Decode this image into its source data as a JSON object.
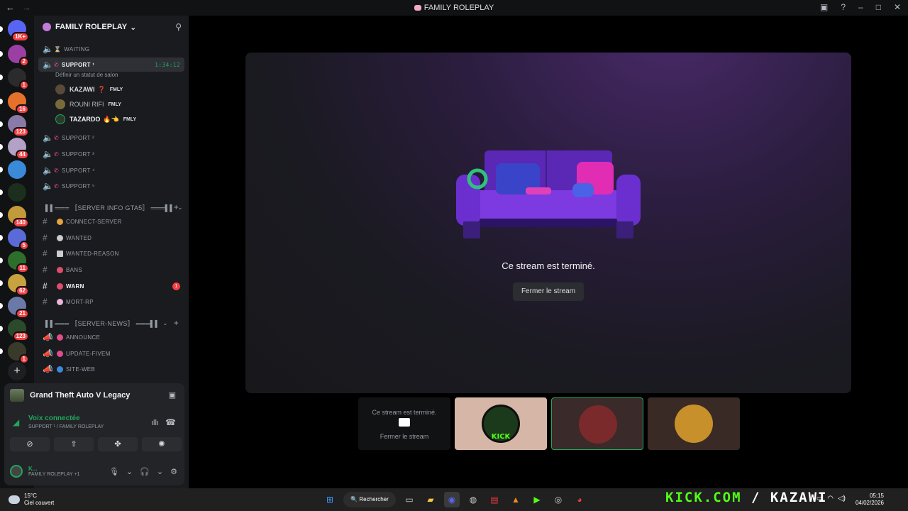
{
  "window": {
    "title": "FAMILY ROLEPLAY"
  },
  "rail": {
    "servers": [
      {
        "badge": "1K+",
        "color": "#5865f2"
      },
      {
        "badge": "2",
        "color": "#9b3fa4"
      },
      {
        "badge": "1",
        "color": "#2b2b2b"
      },
      {
        "badge": "16",
        "color": "#e5712b"
      },
      {
        "badge": "123",
        "color": "#8a7aa8"
      },
      {
        "badge": "44",
        "color": "#b3a1c7"
      },
      {
        "badge": "",
        "color": "#3b8ad9"
      },
      {
        "badge": "",
        "color": "#1c2e1c"
      },
      {
        "badge": "140",
        "color": "#c29a3a"
      },
      {
        "badge": "5",
        "color": "#5a6bd9"
      },
      {
        "badge": "11",
        "color": "#2d6e2d"
      },
      {
        "badge": "62",
        "color": "#c8a23f"
      },
      {
        "badge": "21",
        "color": "#6a79a8"
      },
      {
        "badge": "123",
        "color": "#2b4a2b"
      },
      {
        "badge": "1",
        "color": "#3a3a2a"
      }
    ]
  },
  "guild": {
    "name": "FAMILY ROLEPLAY",
    "channels": [
      {
        "name": "WAITING",
        "icon": "hourglass"
      },
      {
        "name": "SUPPORT ¹",
        "icon": "phone",
        "time": "1:34:12",
        "status": "Définir un statut de salon"
      },
      {
        "name": "SUPPORT ²",
        "icon": "phone"
      },
      {
        "name": "SUPPORT ³",
        "icon": "phone"
      },
      {
        "name": "SUPPORT ⁴",
        "icon": "phone"
      },
      {
        "name": "SUPPORT ⁵",
        "icon": "phone"
      }
    ],
    "voice_users": [
      {
        "name": "KAZAWI",
        "extra": "❓",
        "tag": "FMLY"
      },
      {
        "name": "ROUNI RIFI",
        "extra": "",
        "tag": "FMLY"
      },
      {
        "name": "TAZARDO",
        "extra": "🔥👈",
        "tag": "FMLY"
      }
    ],
    "cat1": "▌▌═══ 〚SERVER INFO GTA5〛 ═══▌▌",
    "text_channels_1": [
      {
        "name": "CONNECT-SERVER",
        "color": "#e7a43a"
      },
      {
        "name": "WANTED",
        "color": "#ccc"
      },
      {
        "name": "WANTED-REASON",
        "color": "#ccc"
      },
      {
        "name": "BANS",
        "color": "#e04d6b"
      },
      {
        "name": "WARN",
        "color": "#e04d6b",
        "unread": "1"
      },
      {
        "name": "MORT-RP",
        "color": "#e8b7d9"
      }
    ],
    "cat2": "▌▌═══ 〚SERVER-NEWS〛 ═══▌▌",
    "text_channels_2": [
      {
        "name": "ANNOUNCE",
        "color": "#e04d8a"
      },
      {
        "name": "UPDATE-FIVEM",
        "color": "#e04d8a"
      },
      {
        "name": "SITE-WEB",
        "color": "#3b8ad9"
      }
    ]
  },
  "activity": {
    "game": "Grand Theft Auto V Legacy",
    "voice_status": "Voix connectée",
    "voice_channel": "SUPPORT ¹ / FAMILY ROLEPLAY",
    "user_name": "K...",
    "user_sub": "FAMILY ROLEPLAY +1"
  },
  "stage": {
    "message": "Ce stream est terminé.",
    "close_label": "Fermer le stream"
  },
  "thumbs": {
    "t1_text": "Ce stream est terminé.",
    "t1_button": "Fermer le stream",
    "kick_label": "KICK"
  },
  "taskbar": {
    "temp": "15°C",
    "weather": "Ciel couvert",
    "search": "Rechercher",
    "overlay_kick": "KICK.COM",
    "overlay_user": " / KAZAWI",
    "time": "05:15",
    "date": "04/02/2026"
  }
}
